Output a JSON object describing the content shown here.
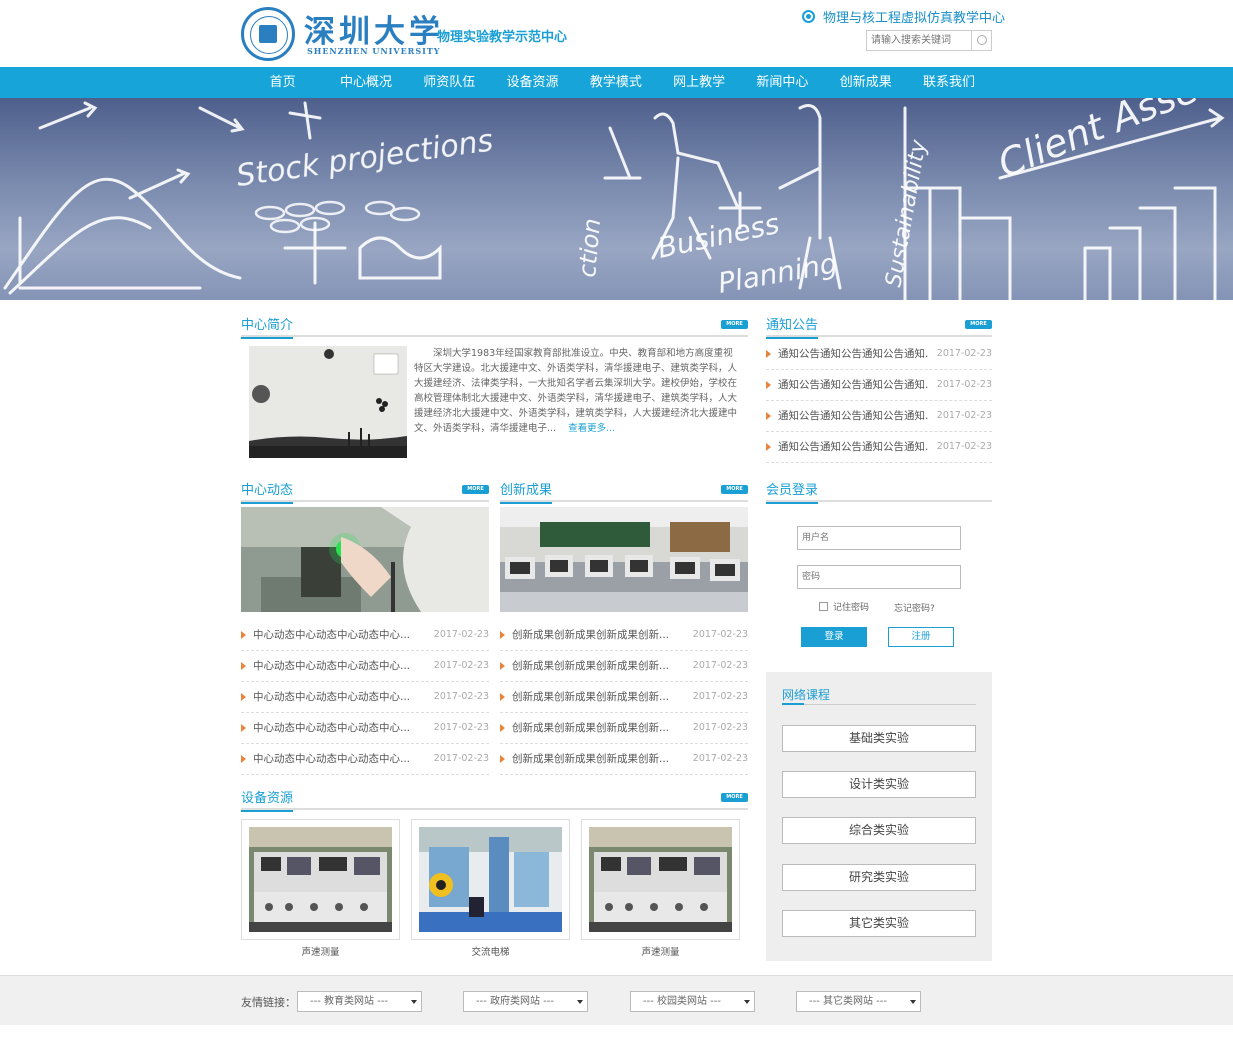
{
  "header": {
    "logo_cn": "深圳大学",
    "logo_en": "SHENZHEN UNIVERSITY",
    "logo_sub": "物理实验教学示范中心",
    "virtual_link": "物理与核工程虚拟仿真教学中心",
    "search_placeholder": "请输入搜索关键词"
  },
  "nav": [
    "首页",
    "中心概况",
    "师资队伍",
    "设备资源",
    "教学模式",
    "网上教学",
    "新闻中心",
    "创新成果",
    "联系我们"
  ],
  "banner": {
    "texts": [
      "Stock projections",
      "Business",
      "Planning",
      "Client Asse",
      "Sustainability",
      "ction"
    ]
  },
  "more_label": "MORE",
  "intro": {
    "title": "中心简介",
    "text": "深圳大学1983年经国家教育部批准设立。中央、教育部和地方高度重视特区大学建设。北大援建中文、外语类学科，清华援建电子、建筑类学科，人大援建经济、法律类学科，一大批知名学者云集深圳大学。建校伊始，学校在高校管理体制北大援建中文、外语类学科，清华援建电子、建筑类学科，人大援建经济北大援建中文、外语类学科，建筑类学科，人大援建经济北大援建中文、外语类学科，清华援建电子...",
    "more_link": "查看更多..."
  },
  "notice": {
    "title": "通知公告",
    "items": [
      {
        "text": "通知公告通知公告通知公告通知...",
        "date": "2017-02-23"
      },
      {
        "text": "通知公告通知公告通知公告通知...",
        "date": "2017-02-23"
      },
      {
        "text": "通知公告通知公告通知公告通知...",
        "date": "2017-02-23"
      },
      {
        "text": "通知公告通知公告通知公告通知...",
        "date": "2017-02-23"
      }
    ]
  },
  "dynamics": {
    "title": "中心动态",
    "items": [
      {
        "text": "中心动态中心动态中心动态中心...",
        "date": "2017-02-23"
      },
      {
        "text": "中心动态中心动态中心动态中心...",
        "date": "2017-02-23"
      },
      {
        "text": "中心动态中心动态中心动态中心...",
        "date": "2017-02-23"
      },
      {
        "text": "中心动态中心动态中心动态中心...",
        "date": "2017-02-23"
      },
      {
        "text": "中心动态中心动态中心动态中心...",
        "date": "2017-02-23"
      }
    ]
  },
  "achievements": {
    "title": "创新成果",
    "items": [
      {
        "text": "创新成果创新成果创新成果创新...",
        "date": "2017-02-23"
      },
      {
        "text": "创新成果创新成果创新成果创新...",
        "date": "2017-02-23"
      },
      {
        "text": "创新成果创新成果创新成果创新...",
        "date": "2017-02-23"
      },
      {
        "text": "创新成果创新成果创新成果创新...",
        "date": "2017-02-23"
      },
      {
        "text": "创新成果创新成果创新成果创新...",
        "date": "2017-02-23"
      }
    ]
  },
  "login": {
    "title": "会员登录",
    "username_placeholder": "用户名",
    "password_placeholder": "密码",
    "remember": "记住密码",
    "forgot": "忘记密码?",
    "login_btn": "登录",
    "register_btn": "注册"
  },
  "courses": {
    "title": "网络课程",
    "items": [
      "基础类实验",
      "设计类实验",
      "综合类实验",
      "研究类实验",
      "其它类实验"
    ]
  },
  "equipment": {
    "title": "设备资源",
    "items": [
      "声速测量",
      "交流电梯",
      "声速测量"
    ]
  },
  "footer": {
    "label": "友情链接：",
    "selects": [
      "--- 教育类网站 ---",
      "--- 政府类网站 ---",
      "--- 校园类网站 ---",
      "--- 其它类网站 ---"
    ]
  },
  "colors": {
    "accent": "#1a9fd4",
    "nav_bg": "#17a5d9",
    "bullet": "#e8843c"
  }
}
